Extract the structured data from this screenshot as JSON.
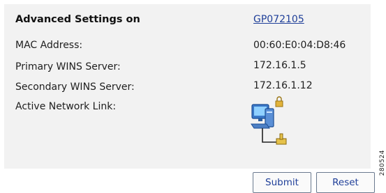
{
  "header": {
    "title": "Advanced Settings on",
    "device_link": "GP072105"
  },
  "fields": [
    {
      "label": "MAC Address:",
      "value": "00:60:E0:04:D8:46"
    },
    {
      "label": "Primary WINS Server:",
      "value": "172.16.1.5"
    },
    {
      "label": "Secondary WINS Server:",
      "value": "172.16.1.12"
    },
    {
      "label": "Active Network Link:",
      "value": ""
    }
  ],
  "icons": {
    "network_link": "network-computer-lock-icon"
  },
  "buttons": {
    "submit_label": "Submit",
    "reset_label": "Reset"
  },
  "figure_id": "280524",
  "colors": {
    "panel_background": "#f2f2f2",
    "link": "#1f3f99",
    "button_text": "#1f3f99"
  }
}
